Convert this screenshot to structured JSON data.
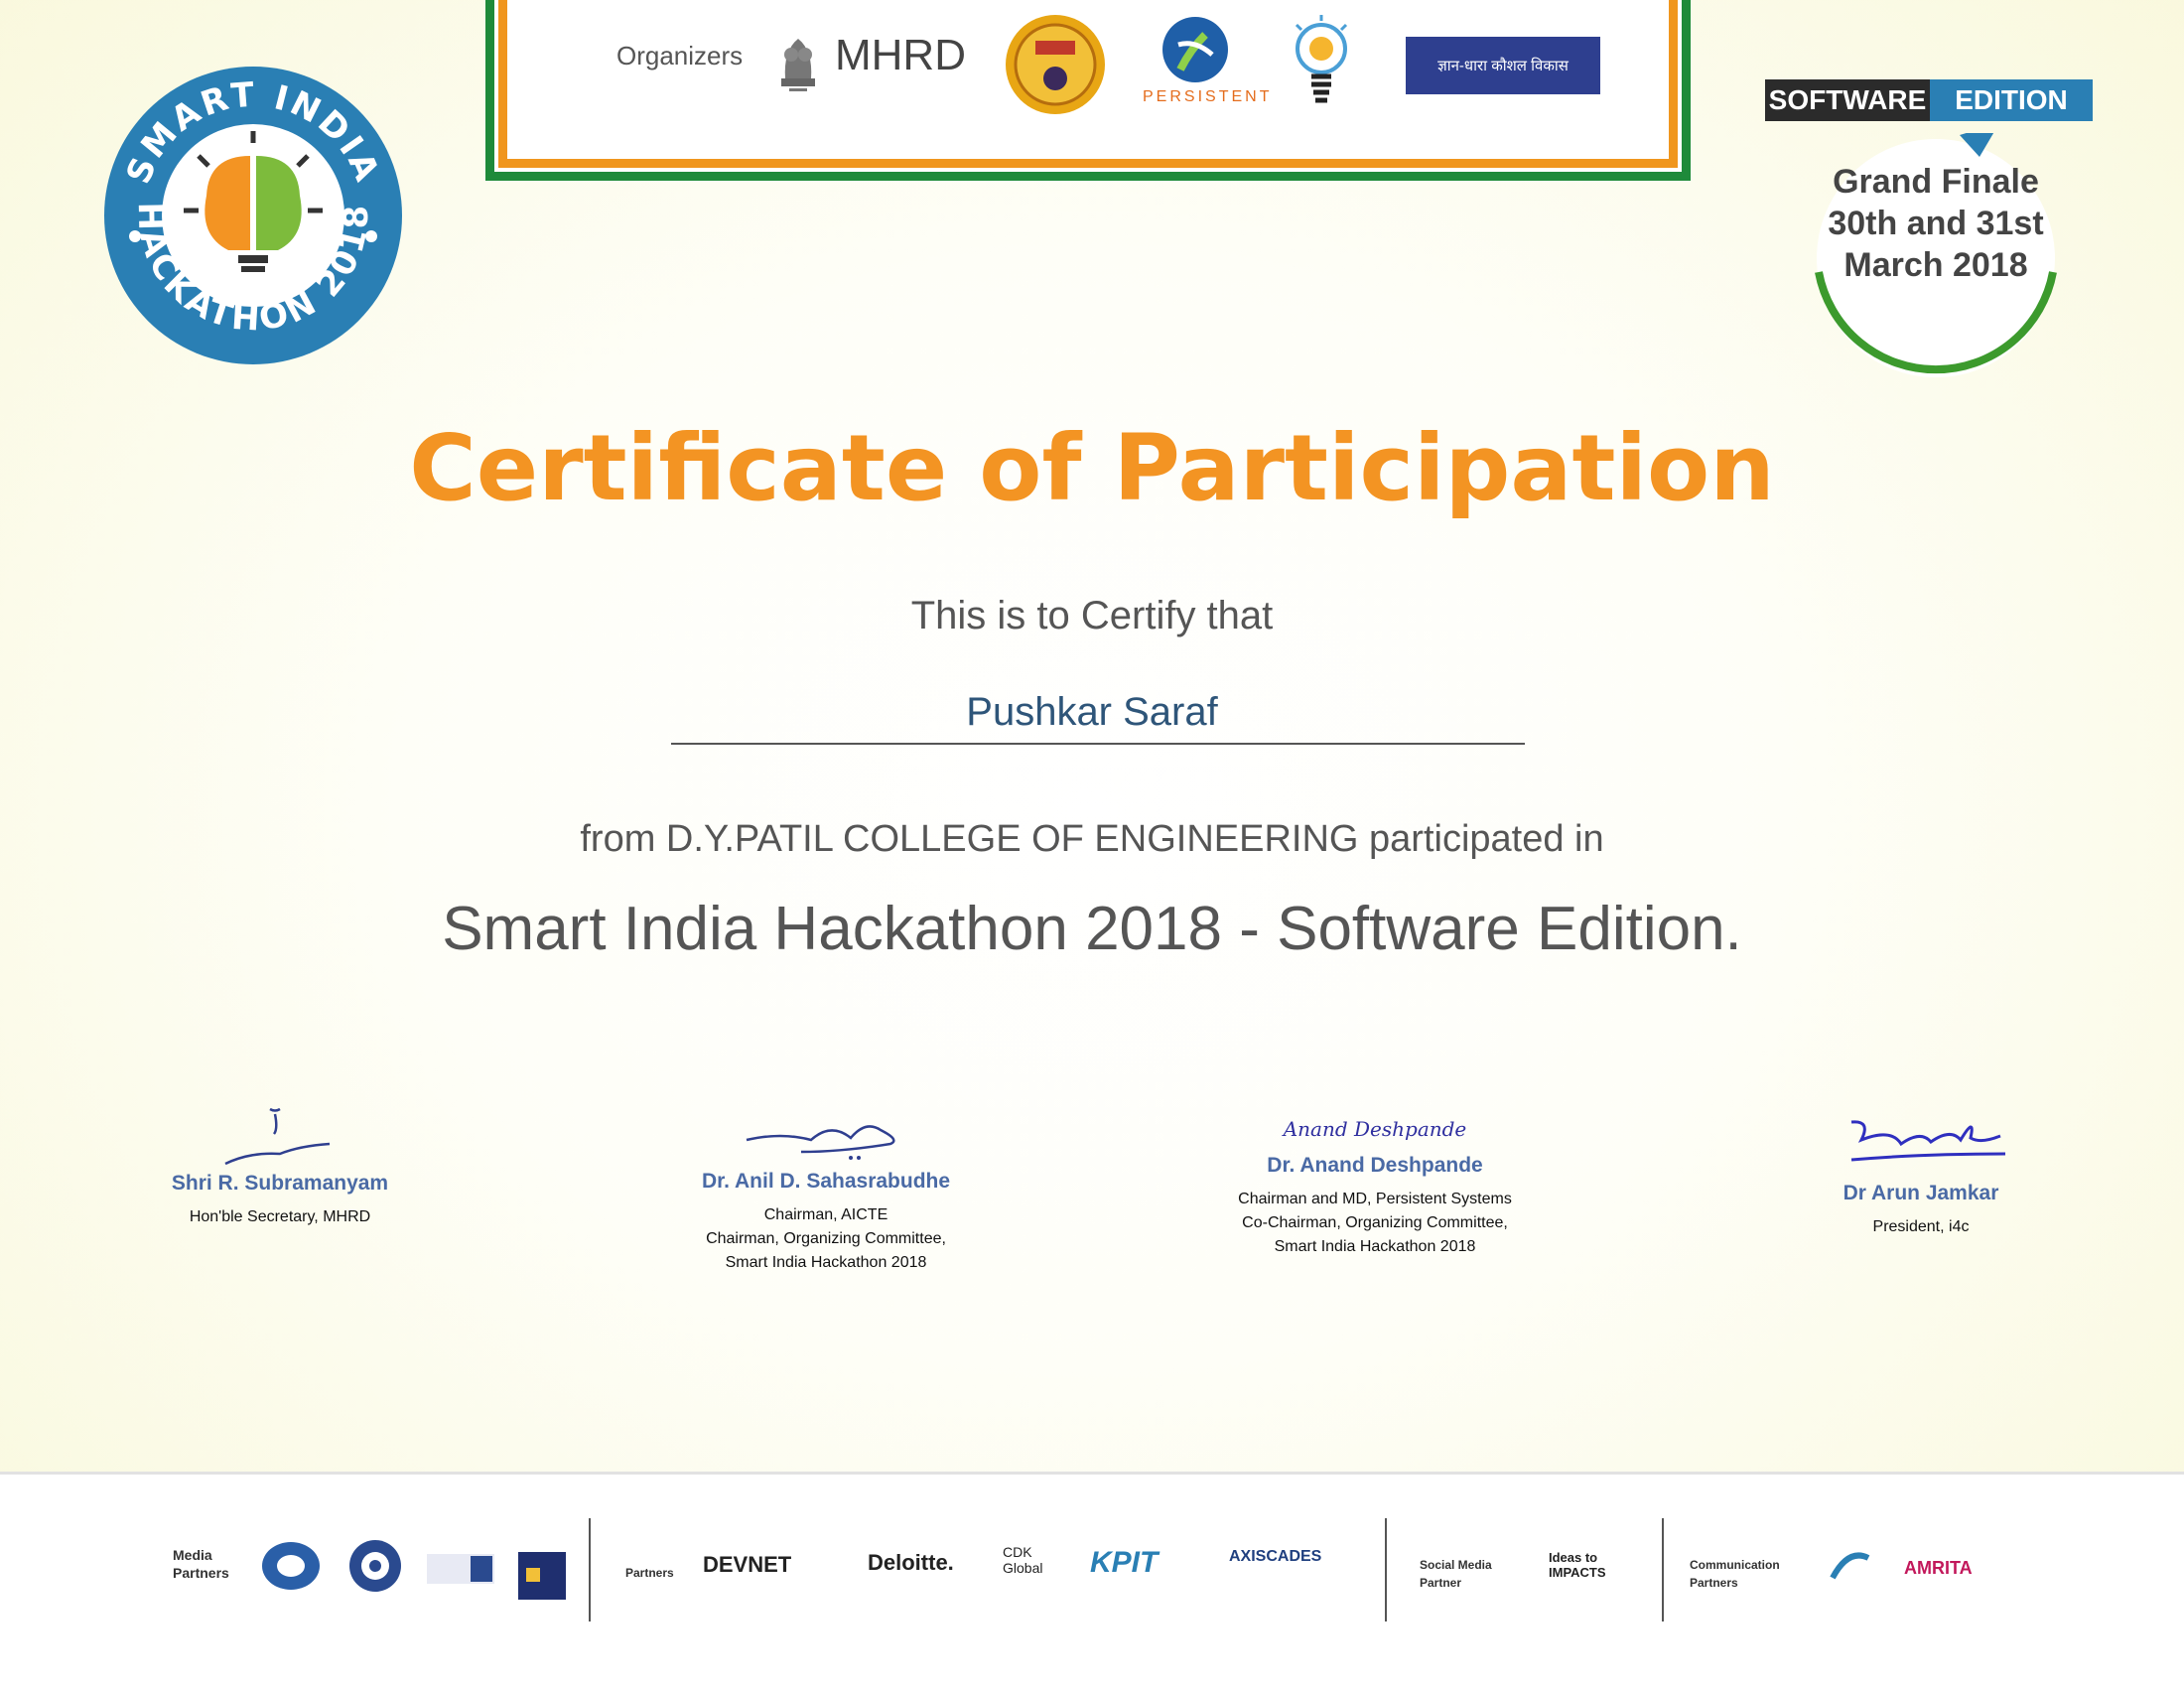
{
  "organizers": {
    "label": "Organizers",
    "mhrd": "MHRD",
    "persistent": "PERSISTENT",
    "kvk": "ज्ञान-धारा कौशल विकास"
  },
  "logo": {
    "arc_top": "SMART INDIA",
    "arc_bottom": "HACKATHON 2018"
  },
  "edition": {
    "software": "SOFTWARE",
    "edition": "EDITION",
    "finale": "Grand Finale\n30th and 31st\nMarch 2018"
  },
  "certificate": {
    "title": "Certificate of Participation",
    "certify": "This is to Certify that",
    "recipient": "Pushkar Saraf",
    "from": "from D.Y.PATIL COLLEGE OF ENGINEERING participated in",
    "event": "Smart India Hackathon 2018 - Software Edition."
  },
  "signatories": [
    {
      "name": "Shri R. Subramanyam",
      "role": "Hon'ble Secretary, MHRD"
    },
    {
      "name": "Dr. Anil D. Sahasrabudhe",
      "role": "Chairman, AICTE\nChairman, Organizing Committee,\nSmart India Hackathon 2018"
    },
    {
      "name": "Dr. Anand Deshpande",
      "role": "Chairman and MD, Persistent Systems\nCo-Chairman, Organizing Committee,\nSmart India Hackathon 2018"
    },
    {
      "name": "Dr Arun Jamkar",
      "role": "President, i4c"
    }
  ],
  "signature_3_text": "Anand Deshpande",
  "footer": {
    "media_label": "Media\nPartners",
    "partners_label": "Partners",
    "social_label": "Social Media\nPartner",
    "comm_label": "Communication\nPartners",
    "devnet": "DEVNET",
    "deloitte": "Deloitte.",
    "cdk": "CDK\nGlobal",
    "kpit": "KPIT",
    "axiscades": "AXISCADES",
    "ideas": "Ideas to\nIMPACTS",
    "amrita": "AMRITA"
  },
  "colors": {
    "title_orange": "#f39423",
    "name_blue": "#2e5579",
    "sig_blue": "#4a6aa5",
    "logo_blue": "#2a7fb4",
    "banner_green": "#1e8a3a",
    "banner_orange": "#f0961e"
  }
}
